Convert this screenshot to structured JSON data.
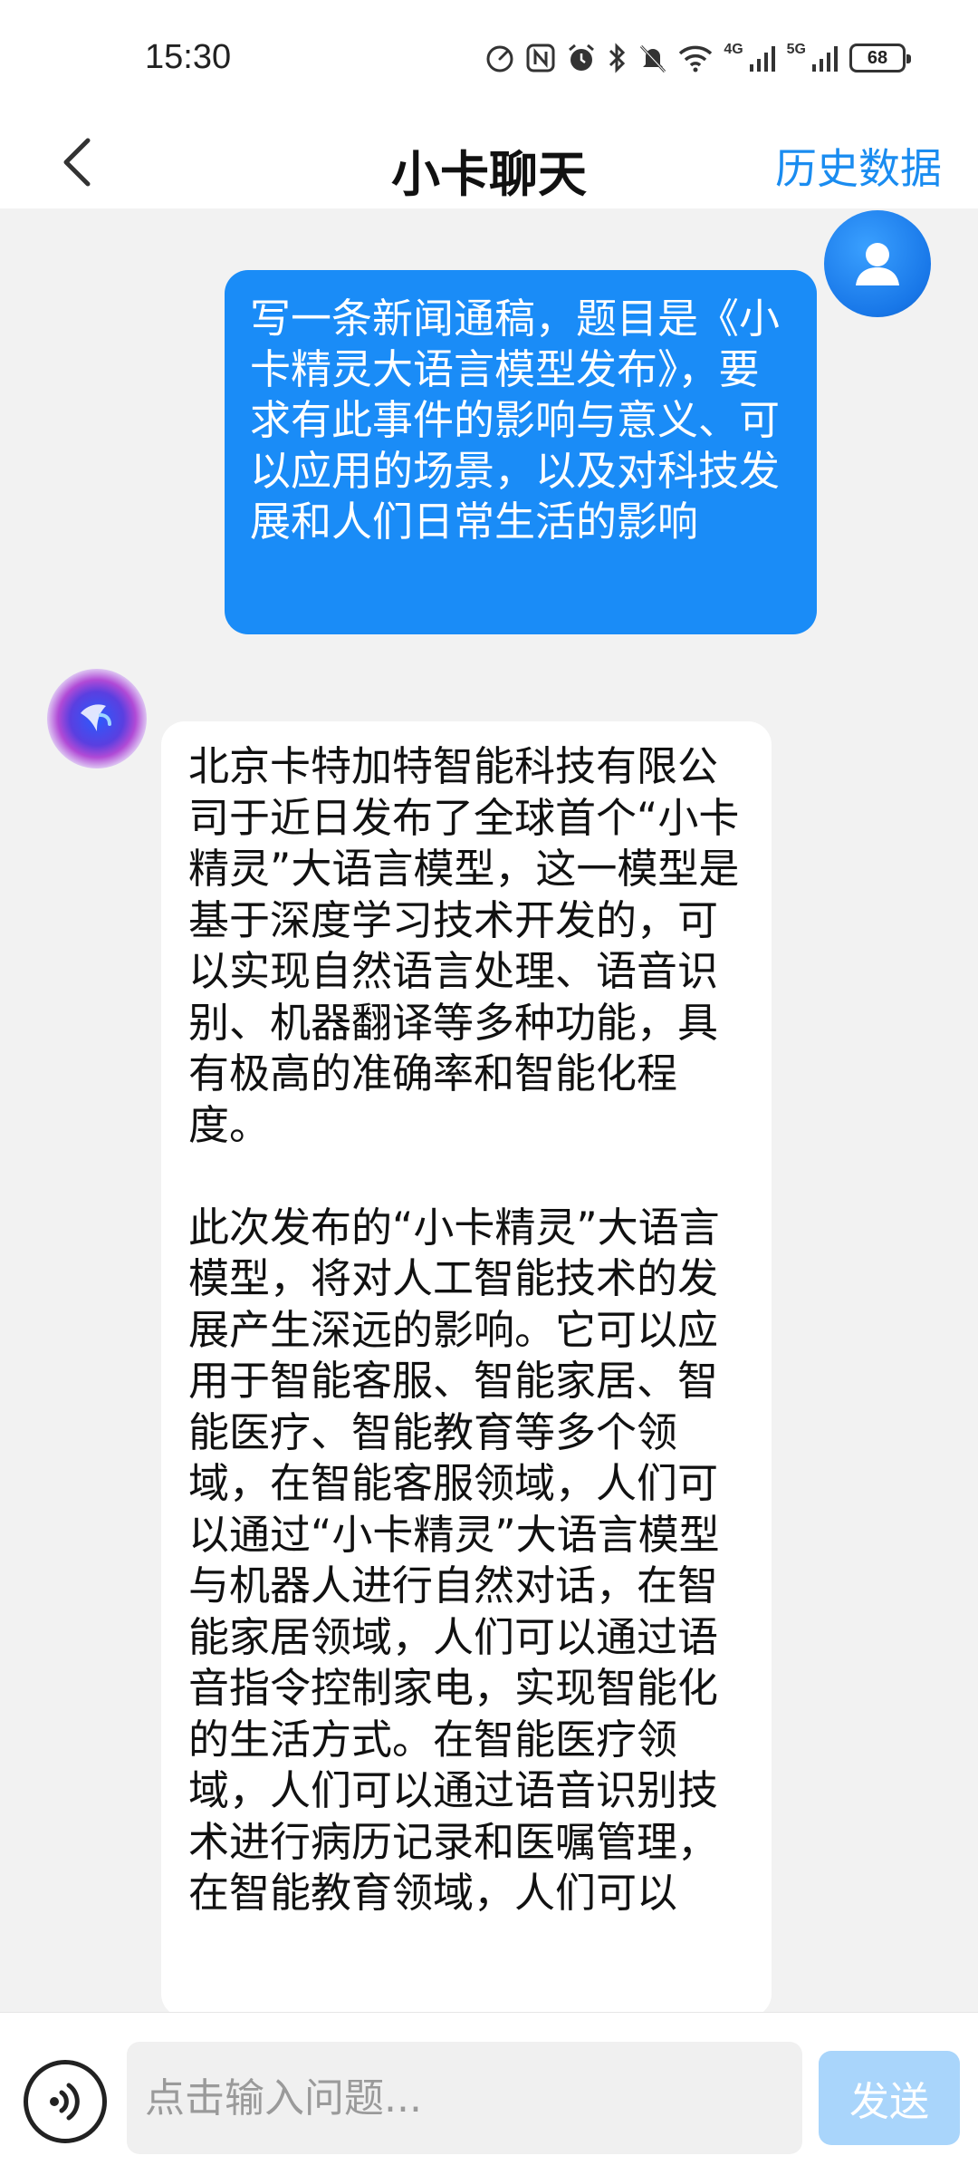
{
  "status_bar": {
    "time": "15:30",
    "signal_1_label": "4G",
    "signal_2_label": "5G",
    "battery": "68",
    "icons": [
      "speed-icon",
      "nfc-icon",
      "alarm-icon",
      "bluetooth-icon",
      "mute-icon",
      "wifi-icon",
      "signal-4g-icon",
      "signal-5g-icon",
      "battery-icon"
    ]
  },
  "header": {
    "title": "小卡聊天",
    "history_label": "历史数据",
    "back_icon": "chevron-left-icon"
  },
  "messages": [
    {
      "role": "user",
      "avatar_icon": "user-icon",
      "text": "写一条新闻通稿，题目是《小卡精灵大语言模型发布》，要求有此事件的影响与意义、可以应用的场景，以及对科技发展和人们日常生活的影响"
    },
    {
      "role": "bot",
      "avatar_icon": "bot-orb-icon",
      "paragraphs": [
        "北京卡特加特智能科技有限公司于近日发布了全球首个“小卡精灵”大语言模型，这一模型是基于深度学习技术开发的，可以实现自然语言处理、语音识别、机器翻译等多种功能，具有极高的准确率和智能化程度。",
        "此次发布的“小卡精灵”大语言模型，将对人工智能技术的发展产生深远的影响。它可以应用于智能客服、智能家居、智能医疗、智能教育等多个领域，在智能客服领域，人们可以通过“小卡精灵”大语言模型与机器人进行自然对话，在智能家居领域，人们可以通过语音指令控制家电，实现智能化的生活方式。在智能医疗领域，人们可以通过语音识别技术进行病历记录和医嘱管理，在智能教育领域，人们可以"
      ]
    }
  ],
  "input_bar": {
    "placeholder": "点击输入问题...",
    "value": "",
    "send_label": "发送",
    "voice_icon": "voice-icon"
  },
  "colors": {
    "accent": "#1a8cf0",
    "user_bubble": "#1a8cf7",
    "send_disabled": "#a9d5fb",
    "background": "#f2f2f2"
  }
}
